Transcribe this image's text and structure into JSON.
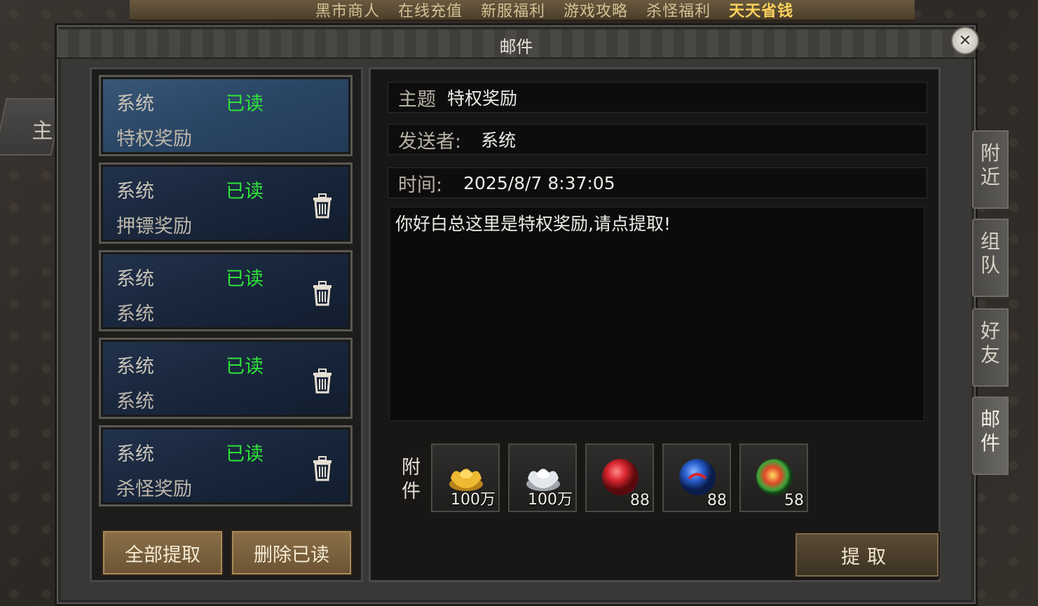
{
  "top_menu": [
    "黑市商人",
    "在线充值",
    "新服福利",
    "游戏攻略",
    "杀怪福利",
    "天天省钱"
  ],
  "left_edge_label": "主",
  "window": {
    "title": "邮件",
    "close_symbol": "✕"
  },
  "mail_list": [
    {
      "sender": "系统",
      "status": "已读",
      "subject": "特权奖励",
      "selected": true,
      "deletable": false
    },
    {
      "sender": "系统",
      "status": "已读",
      "subject": "押镖奖励",
      "selected": false,
      "deletable": true
    },
    {
      "sender": "系统",
      "status": "已读",
      "subject": "系统",
      "selected": false,
      "deletable": true
    },
    {
      "sender": "系统",
      "status": "已读",
      "subject": "系统",
      "selected": false,
      "deletable": true
    },
    {
      "sender": "系统",
      "status": "已读",
      "subject": "杀怪奖励",
      "selected": false,
      "deletable": true
    }
  ],
  "list_buttons": {
    "claim_all": "全部提取",
    "delete_read": "删除已读"
  },
  "detail": {
    "subject_label": "主题",
    "subject": "特权奖励",
    "sender_label": "发送者:",
    "sender": "系统",
    "time_label": "时间:",
    "time": "2025/8/7 8:37:05",
    "body": "你好白总这里是特权奖励,请点提取!"
  },
  "attachments_label": "附件",
  "attachments": [
    {
      "icon": "gold-ingot-icon",
      "count": "100万",
      "color": "#e8b030"
    },
    {
      "icon": "silver-ingot-icon",
      "count": "100万",
      "color": "#d9dde2"
    },
    {
      "icon": "red-orb-icon",
      "count": "88",
      "color": "#d8262e"
    },
    {
      "icon": "blue-orb-icon",
      "count": "88",
      "color": "#2a5fd0"
    },
    {
      "icon": "fire-orb-icon",
      "count": "58",
      "color": "#e0482a"
    }
  ],
  "extract_button": "提取",
  "side_tabs": [
    "附近",
    "组队",
    "好友",
    "邮件"
  ],
  "active_side_tab": "邮件",
  "colors": {
    "read_status": "#2fe43a",
    "selected_item": "#2a4564",
    "unselected_item": "#18253a"
  }
}
